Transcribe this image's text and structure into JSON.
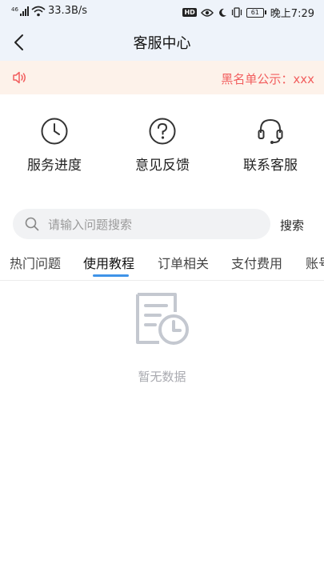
{
  "status_bar": {
    "speed": "33.3B/s",
    "battery": "61",
    "time": "晚上7:29",
    "hd_label": "HD",
    "icons": [
      "signal-icon",
      "wifi-icon",
      "eye-icon",
      "moon-icon",
      "vibrate-icon",
      "battery-icon"
    ]
  },
  "header": {
    "title": "客服中心",
    "back_icon": "chevron-left-icon"
  },
  "notice": {
    "icon": "speaker-icon",
    "text": "黑名单公示：xxx",
    "color": "#f25e5e",
    "background": "#fdf2ea"
  },
  "quick_actions": [
    {
      "label": "服务进度",
      "icon": "clock-icon"
    },
    {
      "label": "意见反馈",
      "icon": "question-icon"
    },
    {
      "label": "联系客服",
      "icon": "headset-icon"
    }
  ],
  "search": {
    "placeholder": "请输入问题搜索",
    "button_label": "搜索"
  },
  "tabs": [
    {
      "label": "热门问题",
      "active": false
    },
    {
      "label": "使用教程",
      "active": true
    },
    {
      "label": "订单相关",
      "active": false
    },
    {
      "label": "支付费用",
      "active": false
    },
    {
      "label": "账号",
      "active": false
    }
  ],
  "accent_color": "#3f93e8",
  "empty_state": {
    "icon": "document-clock-icon",
    "text": "暂无数据"
  }
}
